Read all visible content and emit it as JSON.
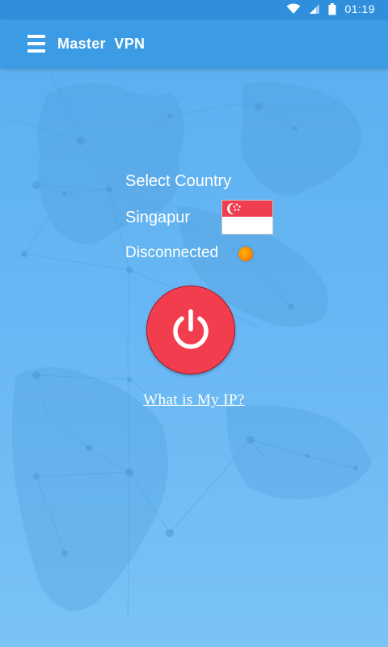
{
  "status_bar": {
    "time": "01:19"
  },
  "app_bar": {
    "title": "Master  VPN"
  },
  "main": {
    "select_country_label": "Select Country",
    "country_name": "Singapur",
    "connection_status": "Disconnected",
    "ip_link": "What is My IP?"
  },
  "colors": {
    "app_bar": "#3b9be5",
    "status_bar": "#2f8fdc",
    "power_button": "#f23d4f",
    "status_dot": "#ff8a00",
    "flag_red": "#ef3e50"
  },
  "icons": {
    "menu": "hamburger-menu-icon",
    "power": "power-icon",
    "wifi": "wifi-icon",
    "signal": "signal-icon",
    "battery": "battery-icon"
  }
}
